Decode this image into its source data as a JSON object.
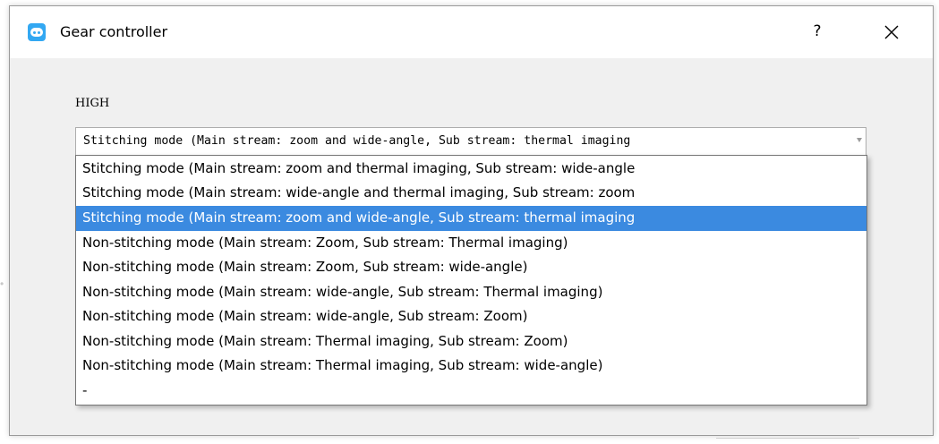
{
  "dialog": {
    "title": "Gear controller",
    "help_label": "?",
    "app_icon": "robot-face-icon",
    "accent_color": "#33a8f2"
  },
  "form": {
    "level_label": "HIGH",
    "mode_select": {
      "selected_value": "Stitching mode (Main stream: zoom and wide-angle, Sub stream: thermal imaging",
      "options": [
        "Stitching mode (Main stream: zoom and thermal imaging, Sub stream: wide-angle",
        "Stitching mode (Main stream: wide-angle and thermal imaging, Sub stream: zoom",
        "Stitching mode (Main stream: zoom and wide-angle, Sub stream: thermal imaging",
        "Non-stitching mode (Main stream: Zoom, Sub stream: Thermal imaging)",
        "Non-stitching mode (Main stream: Zoom, Sub stream: wide-angle)",
        "Non-stitching mode (Main stream: wide-angle, Sub stream: Thermal imaging)",
        "Non-stitching mode (Main stream: wide-angle, Sub stream: Zoom)",
        "Non-stitching mode (Main stream: Thermal imaging, Sub stream: Zoom)",
        "Non-stitching mode (Main stream: Thermal imaging, Sub stream: wide-angle)",
        "-"
      ],
      "highlighted_index": 2,
      "highlight_color": "#3b8ae0"
    }
  }
}
